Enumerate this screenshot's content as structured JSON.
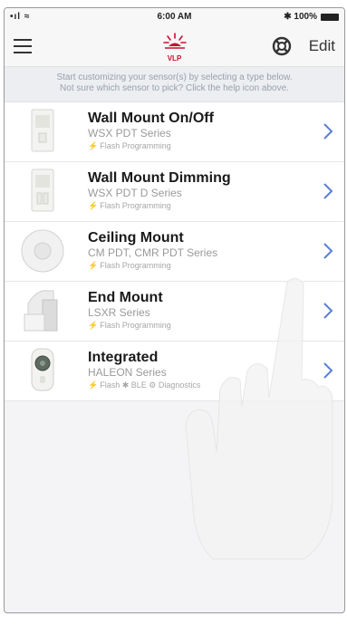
{
  "status_bar": {
    "signal": "•ıl ≈",
    "time": "6:00 AM",
    "battery_text": "✱ 100%"
  },
  "nav": {
    "logo_text": "VLP",
    "edit_label": "Edit"
  },
  "instructions": {
    "line1": "Start customizing your sensor(s) by selecting a type below.",
    "line2": "Not sure which sensor to pick? Click the help icon above."
  },
  "sensors": [
    {
      "title": "Wall Mount On/Off",
      "series": "WSX PDT Series",
      "feature": "Flash Programming"
    },
    {
      "title": "Wall Mount Dimming",
      "series": "WSX PDT D Series",
      "feature": "Flash Programming"
    },
    {
      "title": "Ceiling Mount",
      "series": "CM PDT, CMR PDT Series",
      "feature": "Flash Programming"
    },
    {
      "title": "End Mount",
      "series": "LSXR Series",
      "feature": "Flash Programming"
    },
    {
      "title": "Integrated",
      "series": "HALEON Series",
      "feature": "Flash ✱ BLE ⚙ Diagnostics"
    }
  ],
  "colors": {
    "brand_red": "#c8102e",
    "chevron_blue": "#5b7fd6",
    "text_grey": "#9a9a9a"
  },
  "icons": [
    "hamburger-menu-icon",
    "help-lifebuoy-icon",
    "chevron-right-icon",
    "flash-icon",
    "bluetooth-icon"
  ]
}
